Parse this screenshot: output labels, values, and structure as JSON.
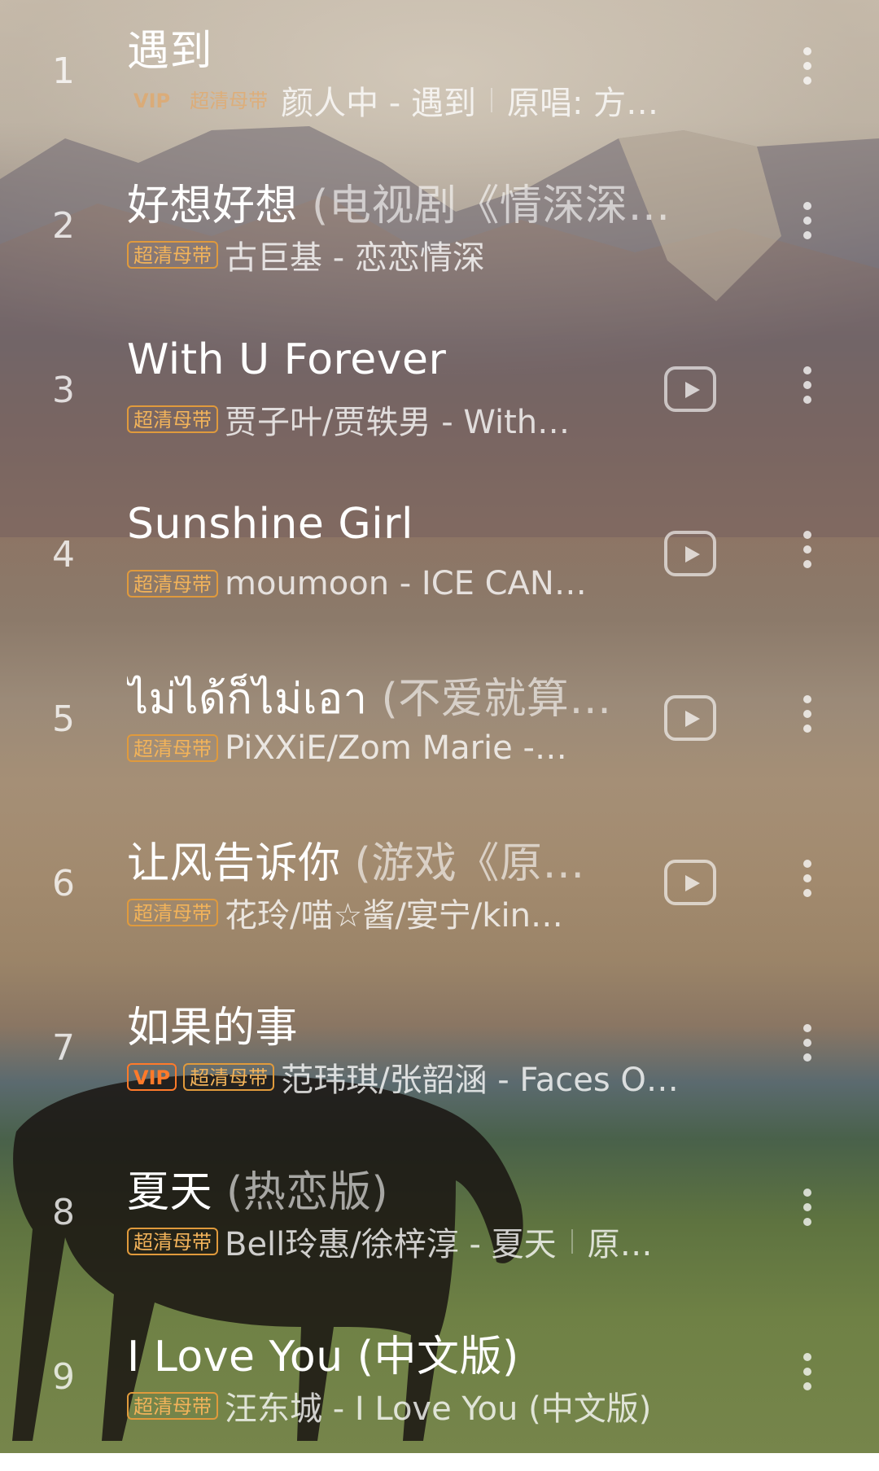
{
  "songs": [
    {
      "rank": "1",
      "title": "遇到",
      "title_suffix": "",
      "badges": [
        {
          "label": "VIP",
          "kind": "vip-faded"
        },
        {
          "label": "超清母带",
          "kind": "faded"
        }
      ],
      "meta_text": "颜人中 - 遇到",
      "meta_extra": "原唱: 方…",
      "has_video": false
    },
    {
      "rank": "2",
      "title": "好想好想",
      "title_suffix": " (电视剧《情深深…",
      "badges": [
        {
          "label": "超清母带",
          "kind": "normal"
        }
      ],
      "meta_text": "古巨基 - 恋恋情深",
      "meta_extra": "",
      "has_video": false
    },
    {
      "rank": "3",
      "title": "With U Forever",
      "title_suffix": "",
      "badges": [
        {
          "label": "超清母带",
          "kind": "normal"
        }
      ],
      "meta_text": "贾子叶/贾轶男 - With…",
      "meta_extra": "",
      "has_video": true
    },
    {
      "rank": "4",
      "title": "Sunshine Girl",
      "title_suffix": "",
      "badges": [
        {
          "label": "超清母带",
          "kind": "normal"
        }
      ],
      "meta_text": "moumoon - ICE CAN…",
      "meta_extra": "",
      "has_video": true
    },
    {
      "rank": "5",
      "title": "ไม่ได้ก็ไม่เอา",
      "title_suffix": " (不爱就算…",
      "badges": [
        {
          "label": "超清母带",
          "kind": "normal"
        }
      ],
      "meta_text": "PiXXiE/Zom Marie -…",
      "meta_extra": "",
      "has_video": true
    },
    {
      "rank": "6",
      "title": "让风告诉你",
      "title_suffix": " (游戏《原…",
      "badges": [
        {
          "label": "超清母带",
          "kind": "normal"
        }
      ],
      "meta_text": "花玲/喵☆酱/宴宁/kin…",
      "meta_extra": "",
      "has_video": true
    },
    {
      "rank": "7",
      "title": "如果的事",
      "title_suffix": "",
      "badges": [
        {
          "label": "VIP",
          "kind": "vip"
        },
        {
          "label": "超清母带",
          "kind": "normal"
        }
      ],
      "meta_text": "范玮琪/张韶涵 - Faces O…",
      "meta_extra": "",
      "has_video": false
    },
    {
      "rank": "8",
      "title": "夏天",
      "title_suffix": " (热恋版)",
      "badges": [
        {
          "label": "超清母带",
          "kind": "normal"
        }
      ],
      "meta_text": "Bell玲惠/徐梓淳 - 夏天",
      "meta_extra": "原…",
      "has_video": false
    },
    {
      "rank": "9",
      "title": "I Love You (中文版)",
      "title_suffix": "",
      "badges": [
        {
          "label": "超清母带",
          "kind": "normal"
        }
      ],
      "meta_text": "汪东城 - I Love You (中文版)",
      "meta_extra": "",
      "has_video": false
    }
  ],
  "icons": {
    "video": "play-video-icon",
    "more": "more-vertical-icon"
  },
  "colors": {
    "badge_gold": "#f2b35a",
    "badge_vip": "#ff7a2a"
  }
}
